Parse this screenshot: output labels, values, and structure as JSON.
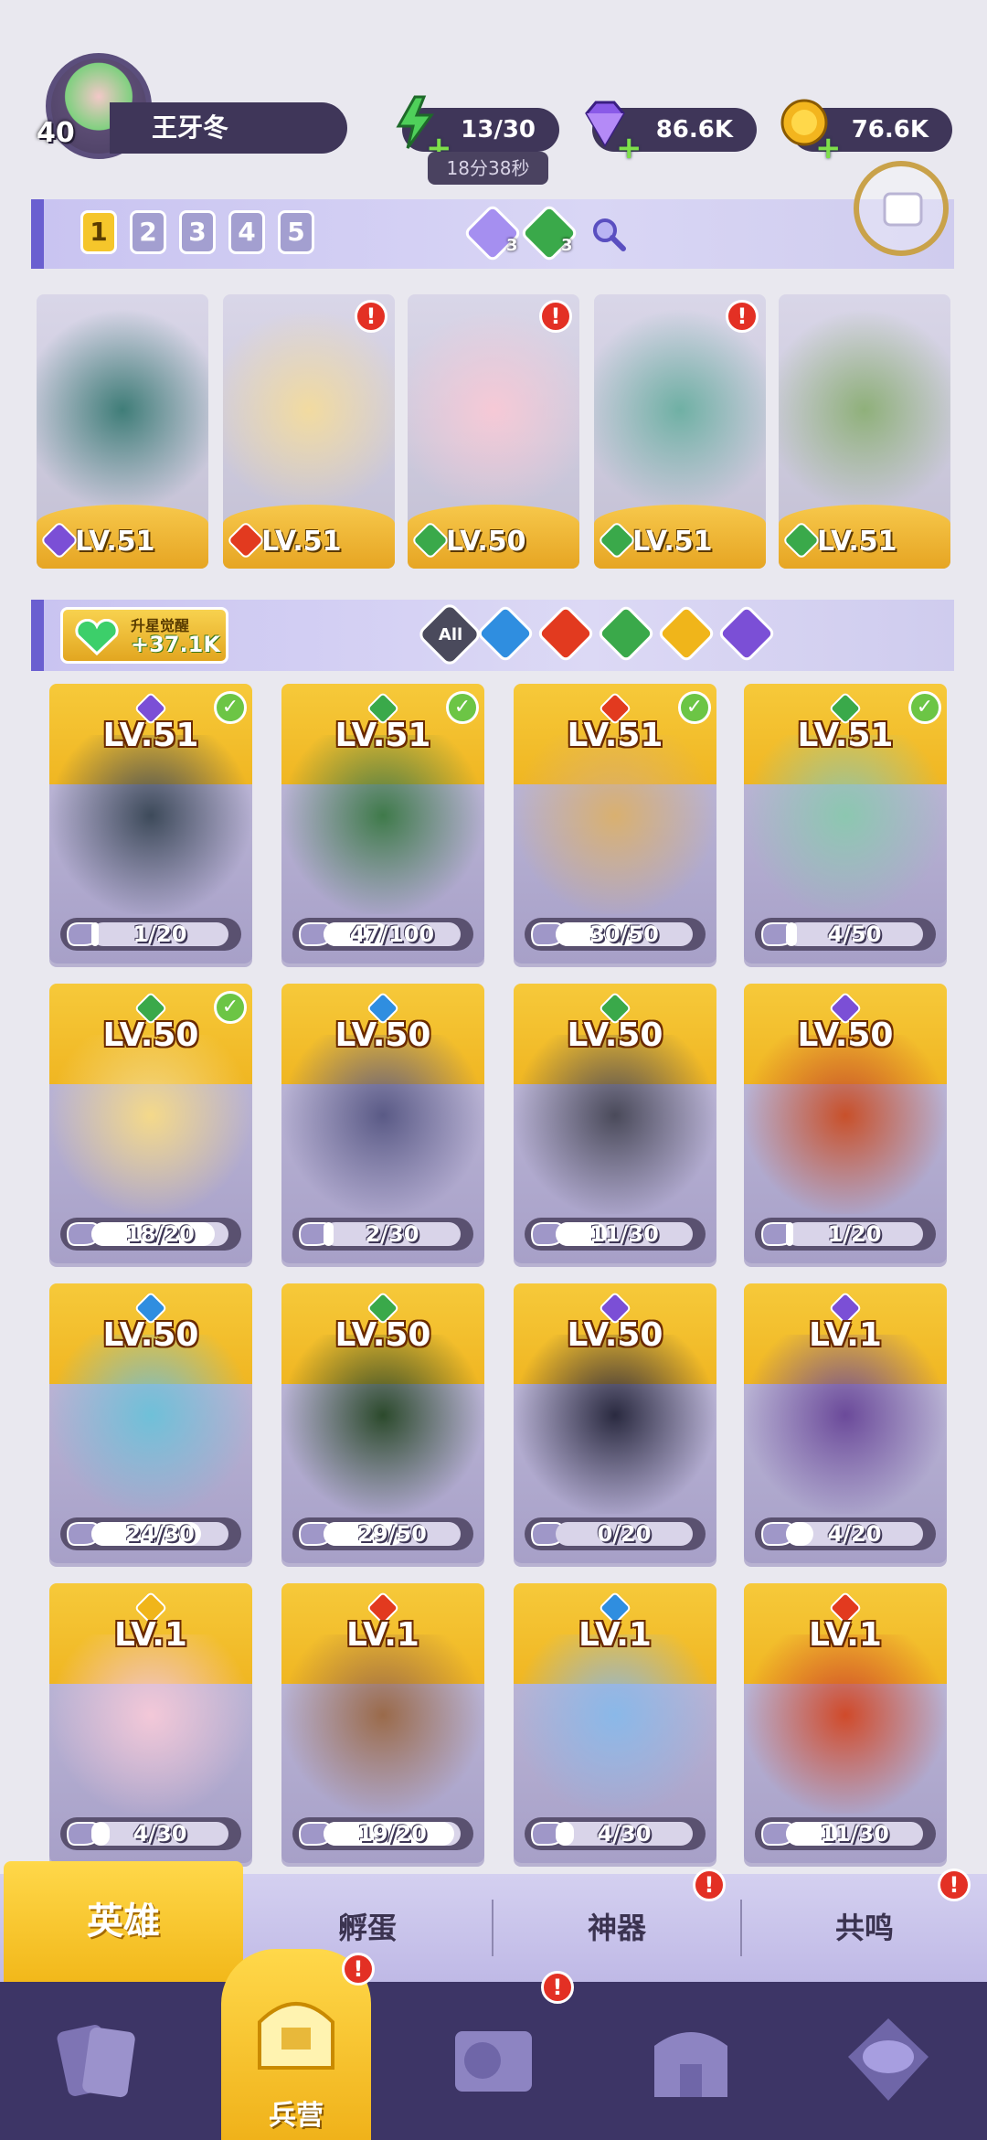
{
  "player": {
    "level": "40",
    "name": "王牙冬"
  },
  "resources": {
    "energy": {
      "value": "13/30",
      "timer": "18分38秒"
    },
    "gems": {
      "value": "86.6K"
    },
    "coins": {
      "value": "76.6K"
    }
  },
  "team": {
    "slots": [
      "1",
      "2",
      "3",
      "4",
      "5"
    ],
    "active_slot": "1",
    "element_counts": [
      {
        "element": "dark",
        "count": "3"
      },
      {
        "element": "nature",
        "count": "3"
      }
    ],
    "heroes": [
      {
        "level": "LV.51",
        "element": "dark",
        "alert": false
      },
      {
        "level": "LV.51",
        "element": "fire",
        "alert": true
      },
      {
        "level": "LV.50",
        "element": "nature",
        "alert": true
      },
      {
        "level": "LV.51",
        "element": "nature",
        "alert": true
      },
      {
        "level": "LV.51",
        "element": "nature",
        "alert": false
      }
    ]
  },
  "awaken": {
    "label": "升星觉醒",
    "value": "+37.1K"
  },
  "filters": {
    "all_label": "All",
    "elements": [
      "water",
      "fire",
      "nature",
      "light",
      "dark"
    ]
  },
  "heroes": [
    {
      "level": "LV.51",
      "element": "dark",
      "progress": "1/20",
      "fill": 0.05,
      "ready": true
    },
    {
      "level": "LV.51",
      "element": "nature",
      "progress": "47/100",
      "fill": 0.47,
      "ready": true
    },
    {
      "level": "LV.51",
      "element": "fire",
      "progress": "30/50",
      "fill": 0.6,
      "ready": true
    },
    {
      "level": "LV.51",
      "element": "nature",
      "progress": "4/50",
      "fill": 0.08,
      "ready": true
    },
    {
      "level": "LV.50",
      "element": "nature",
      "progress": "18/20",
      "fill": 0.9,
      "ready": true
    },
    {
      "level": "LV.50",
      "element": "water",
      "progress": "2/30",
      "fill": 0.07,
      "ready": false
    },
    {
      "level": "LV.50",
      "element": "nature",
      "progress": "11/30",
      "fill": 0.37,
      "ready": false
    },
    {
      "level": "LV.50",
      "element": "dark",
      "progress": "1/20",
      "fill": 0.05,
      "ready": false
    },
    {
      "level": "LV.50",
      "element": "water",
      "progress": "24/30",
      "fill": 0.8,
      "ready": false
    },
    {
      "level": "LV.50",
      "element": "nature",
      "progress": "29/50",
      "fill": 0.58,
      "ready": false
    },
    {
      "level": "LV.50",
      "element": "dark",
      "progress": "0/20",
      "fill": 0.0,
      "ready": false
    },
    {
      "level": "LV.1",
      "element": "dark",
      "progress": "4/20",
      "fill": 0.2,
      "ready": false
    },
    {
      "level": "LV.1",
      "element": "light",
      "progress": "4/30",
      "fill": 0.13,
      "ready": false
    },
    {
      "level": "LV.1",
      "element": "fire",
      "progress": "19/20",
      "fill": 0.95,
      "ready": false
    },
    {
      "level": "LV.1",
      "element": "water",
      "progress": "4/30",
      "fill": 0.13,
      "ready": false
    },
    {
      "level": "LV.1",
      "element": "fire",
      "progress": "11/30",
      "fill": 0.37,
      "ready": false
    }
  ],
  "tabs": [
    {
      "label": "英雄",
      "active": true,
      "alert": false
    },
    {
      "label": "孵蛋",
      "active": false,
      "alert": false
    },
    {
      "label": "神器",
      "active": false,
      "alert": true
    },
    {
      "label": "共鸣",
      "active": false,
      "alert": true
    }
  ],
  "nav": [
    {
      "label": "",
      "icon": "cards-icon",
      "active": false,
      "alert": false
    },
    {
      "label": "兵营",
      "icon": "barracks-icon",
      "active": true,
      "alert": true
    },
    {
      "label": "",
      "icon": "map-icon",
      "active": false,
      "alert": true
    },
    {
      "label": "",
      "icon": "castle-icon",
      "active": false,
      "alert": false
    },
    {
      "label": "",
      "icon": "mushroom-icon",
      "active": false,
      "alert": false
    }
  ],
  "colors": {
    "dark": "#7b4fd6",
    "nature": "#3aa94a",
    "fire": "#e23a1f",
    "water": "#2f8ee0",
    "light": "#f0b51a",
    "accent": "#f5c62b",
    "nav_bg": "#3d3566"
  }
}
